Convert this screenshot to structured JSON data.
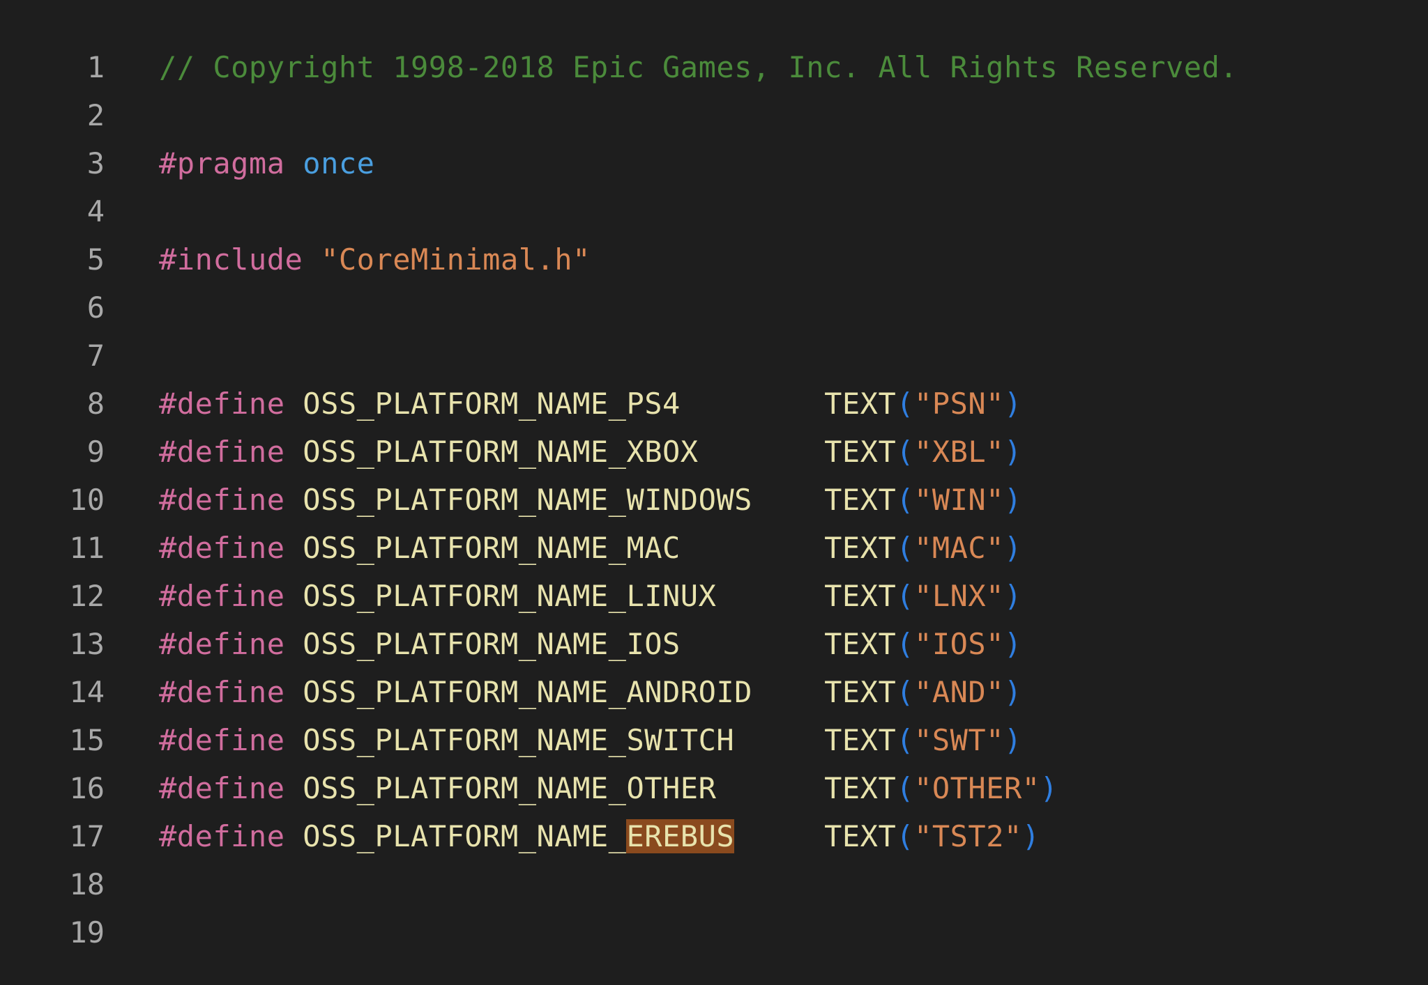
{
  "editor": {
    "language": "cpp",
    "background_color": "#1e1e1e",
    "gutter_color": "#a8a8a8",
    "selection_highlight_color": "#8a4a1e",
    "colors": {
      "comment": "#4b8b3b",
      "preprocessor": "#d16d9e",
      "keyword": "#4a9fe0",
      "string": "#d98855",
      "macro_name": "#e8e3ad",
      "function": "#e8e3ad",
      "paren": "#2f7ee0",
      "plain": "#d4d4d4"
    },
    "lines": [
      {
        "number": "1",
        "tokens": [
          {
            "text": "// Copyright 1998-2018 Epic Games, Inc. All Rights Reserved.",
            "kind": "comment"
          }
        ]
      },
      {
        "number": "2",
        "tokens": []
      },
      {
        "number": "3",
        "tokens": [
          {
            "text": "#pragma ",
            "kind": "pre"
          },
          {
            "text": "once",
            "kind": "keyword"
          }
        ]
      },
      {
        "number": "4",
        "tokens": []
      },
      {
        "number": "5",
        "tokens": [
          {
            "text": "#include ",
            "kind": "pre"
          },
          {
            "text": "\"CoreMinimal.h\"",
            "kind": "string"
          }
        ]
      },
      {
        "number": "6",
        "tokens": []
      },
      {
        "number": "7",
        "tokens": []
      },
      {
        "number": "8",
        "tokens": [
          {
            "text": "#define ",
            "kind": "pre"
          },
          {
            "text": "OSS_PLATFORM_NAME_PS4",
            "kind": "macro"
          },
          {
            "text": "        ",
            "kind": "plain"
          },
          {
            "text": "TEXT",
            "kind": "func"
          },
          {
            "text": "(",
            "kind": "paren"
          },
          {
            "text": "\"PSN\"",
            "kind": "string"
          },
          {
            "text": ")",
            "kind": "paren"
          }
        ]
      },
      {
        "number": "9",
        "tokens": [
          {
            "text": "#define ",
            "kind": "pre"
          },
          {
            "text": "OSS_PLATFORM_NAME_XBOX",
            "kind": "macro"
          },
          {
            "text": "       ",
            "kind": "plain"
          },
          {
            "text": "TEXT",
            "kind": "func"
          },
          {
            "text": "(",
            "kind": "paren"
          },
          {
            "text": "\"XBL\"",
            "kind": "string"
          },
          {
            "text": ")",
            "kind": "paren"
          }
        ]
      },
      {
        "number": "10",
        "tokens": [
          {
            "text": "#define ",
            "kind": "pre"
          },
          {
            "text": "OSS_PLATFORM_NAME_WINDOWS",
            "kind": "macro"
          },
          {
            "text": "    ",
            "kind": "plain"
          },
          {
            "text": "TEXT",
            "kind": "func"
          },
          {
            "text": "(",
            "kind": "paren"
          },
          {
            "text": "\"WIN\"",
            "kind": "string"
          },
          {
            "text": ")",
            "kind": "paren"
          }
        ]
      },
      {
        "number": "11",
        "tokens": [
          {
            "text": "#define ",
            "kind": "pre"
          },
          {
            "text": "OSS_PLATFORM_NAME_MAC",
            "kind": "macro"
          },
          {
            "text": "        ",
            "kind": "plain"
          },
          {
            "text": "TEXT",
            "kind": "func"
          },
          {
            "text": "(",
            "kind": "paren"
          },
          {
            "text": "\"MAC\"",
            "kind": "string"
          },
          {
            "text": ")",
            "kind": "paren"
          }
        ]
      },
      {
        "number": "12",
        "tokens": [
          {
            "text": "#define ",
            "kind": "pre"
          },
          {
            "text": "OSS_PLATFORM_NAME_LINUX",
            "kind": "macro"
          },
          {
            "text": "      ",
            "kind": "plain"
          },
          {
            "text": "TEXT",
            "kind": "func"
          },
          {
            "text": "(",
            "kind": "paren"
          },
          {
            "text": "\"LNX\"",
            "kind": "string"
          },
          {
            "text": ")",
            "kind": "paren"
          }
        ]
      },
      {
        "number": "13",
        "tokens": [
          {
            "text": "#define ",
            "kind": "pre"
          },
          {
            "text": "OSS_PLATFORM_NAME_IOS",
            "kind": "macro"
          },
          {
            "text": "        ",
            "kind": "plain"
          },
          {
            "text": "TEXT",
            "kind": "func"
          },
          {
            "text": "(",
            "kind": "paren"
          },
          {
            "text": "\"IOS\"",
            "kind": "string"
          },
          {
            "text": ")",
            "kind": "paren"
          }
        ]
      },
      {
        "number": "14",
        "tokens": [
          {
            "text": "#define ",
            "kind": "pre"
          },
          {
            "text": "OSS_PLATFORM_NAME_ANDROID",
            "kind": "macro"
          },
          {
            "text": "    ",
            "kind": "plain"
          },
          {
            "text": "TEXT",
            "kind": "func"
          },
          {
            "text": "(",
            "kind": "paren"
          },
          {
            "text": "\"AND\"",
            "kind": "string"
          },
          {
            "text": ")",
            "kind": "paren"
          }
        ]
      },
      {
        "number": "15",
        "tokens": [
          {
            "text": "#define ",
            "kind": "pre"
          },
          {
            "text": "OSS_PLATFORM_NAME_SWITCH",
            "kind": "macro"
          },
          {
            "text": "     ",
            "kind": "plain"
          },
          {
            "text": "TEXT",
            "kind": "func"
          },
          {
            "text": "(",
            "kind": "paren"
          },
          {
            "text": "\"SWT\"",
            "kind": "string"
          },
          {
            "text": ")",
            "kind": "paren"
          }
        ]
      },
      {
        "number": "16",
        "tokens": [
          {
            "text": "#define ",
            "kind": "pre"
          },
          {
            "text": "OSS_PLATFORM_NAME_OTHER",
            "kind": "macro"
          },
          {
            "text": "      ",
            "kind": "plain"
          },
          {
            "text": "TEXT",
            "kind": "func"
          },
          {
            "text": "(",
            "kind": "paren"
          },
          {
            "text": "\"OTHER\"",
            "kind": "string"
          },
          {
            "text": ")",
            "kind": "paren"
          }
        ]
      },
      {
        "number": "17",
        "tokens": [
          {
            "text": "#define ",
            "kind": "pre"
          },
          {
            "text": "OSS_PLATFORM_NAME_",
            "kind": "macro"
          },
          {
            "text": "EREBUS",
            "kind": "macro",
            "selected": true
          },
          {
            "text": "     ",
            "kind": "plain"
          },
          {
            "text": "TEXT",
            "kind": "func"
          },
          {
            "text": "(",
            "kind": "paren"
          },
          {
            "text": "\"TST2\"",
            "kind": "string"
          },
          {
            "text": ")",
            "kind": "paren"
          }
        ]
      },
      {
        "number": "18",
        "tokens": []
      },
      {
        "number": "19",
        "tokens": []
      }
    ]
  }
}
